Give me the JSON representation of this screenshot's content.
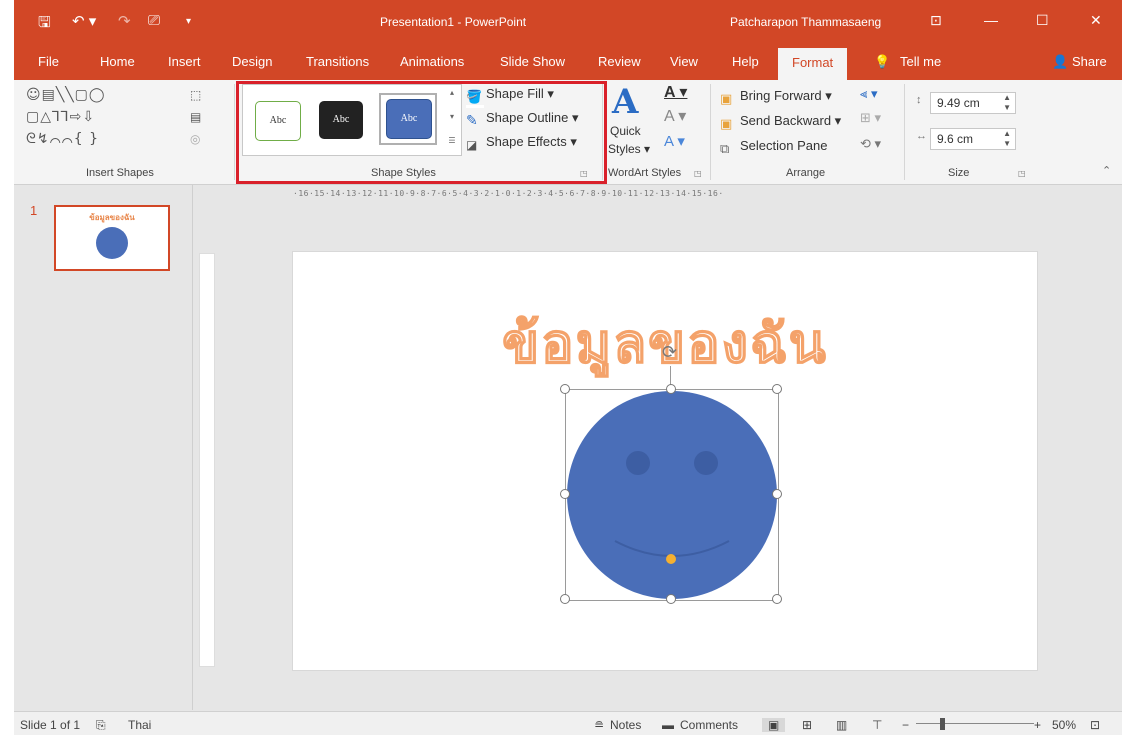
{
  "window": {
    "title": "Presentation1  -  PowerPoint",
    "user": "Patcharapon Thammasaeng"
  },
  "qat": {
    "save": "🖫",
    "undo": "↶ ▾",
    "redo": "↷",
    "present": "⎚",
    "more": "▾"
  },
  "tabs": [
    "File",
    "Home",
    "Insert",
    "Design",
    "Transitions",
    "Animations",
    "Slide Show",
    "Review",
    "View",
    "Help",
    "Format"
  ],
  "active_tab": "Format",
  "tell_me": "Tell me",
  "share": "Share",
  "ribbon": {
    "insert_shapes": {
      "label": "Insert Shapes",
      "row1": "☺▤╲╲▢◯",
      "row2": "▢△⅂⅂⇨⇩",
      "row3": "ᘓ↯⌒⌒{ }"
    },
    "shape_styles": {
      "label": "Shape Styles",
      "thumb_text": "Abc",
      "fill": "Shape Fill",
      "outline": "Shape Outline",
      "effects": "Shape Effects"
    },
    "wordart": {
      "label": "WordArt Styles",
      "quick": "Quick",
      "styles": "Styles"
    },
    "arrange": {
      "label": "Arrange",
      "bring_forward": "Bring Forward",
      "send_backward": "Send Backward",
      "selection_pane": "Selection Pane"
    },
    "size": {
      "label": "Size",
      "height": "9.49 cm",
      "width": "9.6 cm"
    }
  },
  "slide_panel": {
    "number": "1",
    "thumb_title": "ข้อมูลของฉัน"
  },
  "slide": {
    "title": "ข้อมูลของฉัน"
  },
  "ruler_h": "·16·15·14·13·12·11·10·9·8·7·6·5·4·3·2·1·0·1·2·3·4·5·6·7·8·9·10·11·12·13·14·15·16·",
  "status": {
    "slide": "Slide 1 of 1",
    "language": "Thai",
    "notes": "Notes",
    "comments": "Comments",
    "zoom": "50%"
  },
  "colors": {
    "accent": "#d24726",
    "shape_fill": "#4a6eb8",
    "title_outline": "#f4a26a",
    "highlight": "#d9202a"
  }
}
